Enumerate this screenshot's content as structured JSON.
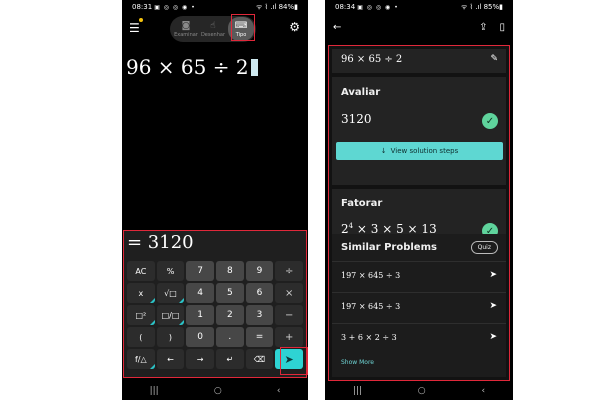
{
  "left": {
    "status": {
      "time": "08:31",
      "icons": "▣ ◎ ◎ ◉ •",
      "right": "ᯤ ⌇ .ıl 84%▮"
    },
    "modes": [
      {
        "label": "Examinar",
        "icon": "camera-icon",
        "glyph": "◙"
      },
      {
        "label": "Desenhar",
        "icon": "hand-draw-icon",
        "glyph": "☝"
      },
      {
        "label": "Tipo",
        "icon": "keyboard-icon",
        "glyph": "⌨"
      }
    ],
    "menu_glyph": "☰",
    "settings_glyph": "⚙",
    "expression": "96 × 65 ÷ 2",
    "result": "= 3120",
    "keys": [
      {
        "label": "AC",
        "type": "func"
      },
      {
        "label": "%",
        "type": "func"
      },
      {
        "label": "7",
        "type": "num"
      },
      {
        "label": "8",
        "type": "num"
      },
      {
        "label": "9",
        "type": "num"
      },
      {
        "label": "÷",
        "type": "op"
      },
      {
        "label": "x",
        "type": "func",
        "corner": true
      },
      {
        "label": "√□",
        "type": "func",
        "corner": true
      },
      {
        "label": "4",
        "type": "num"
      },
      {
        "label": "5",
        "type": "num"
      },
      {
        "label": "6",
        "type": "num"
      },
      {
        "label": "×",
        "type": "op"
      },
      {
        "label": "□²",
        "type": "func",
        "corner": true
      },
      {
        "label": "□/□",
        "type": "func",
        "corner": true
      },
      {
        "label": "1",
        "type": "num"
      },
      {
        "label": "2",
        "type": "num"
      },
      {
        "label": "3",
        "type": "num"
      },
      {
        "label": "−",
        "type": "op"
      },
      {
        "label": "(",
        "type": "func"
      },
      {
        "label": ")",
        "type": "func"
      },
      {
        "label": "0",
        "type": "num"
      },
      {
        "label": ".",
        "type": "num"
      },
      {
        "label": "=",
        "type": "num"
      },
      {
        "label": "+",
        "type": "op"
      },
      {
        "label": "f/△",
        "type": "func",
        "corner": true
      },
      {
        "label": "←",
        "type": "func"
      },
      {
        "label": "→",
        "type": "func"
      },
      {
        "label": "↵",
        "type": "func"
      },
      {
        "label": "⌫",
        "type": "func"
      },
      {
        "label": "➤",
        "type": "enter"
      }
    ],
    "nav": [
      "|||",
      "○",
      "‹"
    ]
  },
  "right": {
    "status": {
      "time": "08:34",
      "icons": "▣ ◎ ◎ ◉ •",
      "right": "ᯤ ⌇ .ıl 85%▮"
    },
    "back_glyph": "←",
    "share_glyph": "⇪",
    "bookmark_glyph": "▯",
    "expression": "96 × 65 ÷ 2",
    "edit_glyph": "✎",
    "avaliar": {
      "title": "Avaliar",
      "result": "3120",
      "button": "View solution steps",
      "button_glyph": "↓",
      "check": "✓"
    },
    "fatorar": {
      "title": "Fatorar",
      "base": "2",
      "exp": "4",
      "rest": " × 3 × 5 × 13",
      "check": "✓"
    },
    "similar": {
      "title": "Similar Problems",
      "quiz": "Quiz",
      "items": [
        "197 × 645 ÷ 3",
        "197 × 645 ÷ 3",
        "3 + 6 × 2 ÷ 3"
      ],
      "send_glyph": "➤",
      "show_more": "Show More"
    },
    "nav": [
      "|||",
      "○",
      "‹"
    ]
  }
}
